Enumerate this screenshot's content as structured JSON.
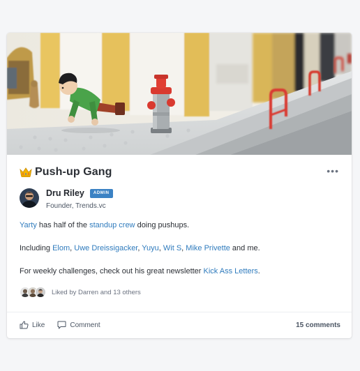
{
  "post": {
    "title": "Push-up Gang",
    "more_label": "•••",
    "author": {
      "name": "Dru Riley",
      "badge": "ADMIN",
      "subtitle": "Founder, Trends.vc"
    },
    "paragraph1": {
      "link1": "Yarty",
      "text1": " has half of the ",
      "link2": "standup crew",
      "text2": " doing pushups."
    },
    "paragraph2": {
      "text_start": "Including ",
      "mentions": [
        "Elom",
        "Uwe Dreissigacker",
        "Yuyu",
        "Wit S",
        "Mike Privette"
      ],
      "sep": ", ",
      "text_end": " and me."
    },
    "paragraph3": {
      "text": "For weekly challenges, check out his great newsletter ",
      "link": "Kick Ass Letters",
      "end": "."
    },
    "likes_text": "Liked by Darren and 13 others",
    "actions": {
      "like": "Like",
      "comment": "Comment",
      "comments_count": "15 comments"
    }
  },
  "colors": {
    "link": "#2f7bbd",
    "badge": "#3b82c4",
    "background": "#f5f6f8"
  },
  "icons": {
    "title": "crown-icon",
    "like": "thumbs-up-icon",
    "comment": "comment-bubble-icon",
    "more": "more-dots-icon"
  }
}
